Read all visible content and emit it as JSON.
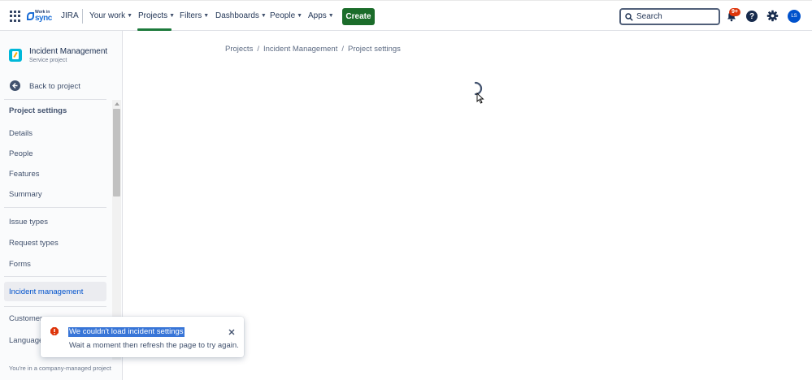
{
  "topnav": {
    "logo_line1": "Work in",
    "logo_line2": "sync",
    "product": "JIRA",
    "items": [
      {
        "label": "Your work"
      },
      {
        "label": "Projects"
      },
      {
        "label": "Filters"
      },
      {
        "label": "Dashboards"
      },
      {
        "label": "People"
      },
      {
        "label": "Apps"
      }
    ],
    "active_item": "Projects",
    "create_label": "Create",
    "search_placeholder": "Search",
    "notification_badge": "9+",
    "help_glyph": "?",
    "avatar_initials": "LS",
    "icons": [
      "app-switcher-icon",
      "search-icon",
      "bell-icon",
      "help-icon",
      "gear-icon"
    ],
    "colors": {
      "create": "#1b6c2a",
      "active_underline": "#1d7a3c",
      "badge": "#de350b",
      "avatar": "#0052cc"
    }
  },
  "sidebar": {
    "project_name": "Incident Management",
    "project_type": "Service project",
    "back_label": "Back to project",
    "heading": "Project settings",
    "groups": [
      [
        {
          "label": "Details"
        },
        {
          "label": "People"
        },
        {
          "label": "Features"
        },
        {
          "label": "Summary"
        }
      ],
      [
        {
          "label": "Issue types"
        },
        {
          "label": "Request types"
        },
        {
          "label": "Forms"
        }
      ],
      [
        {
          "label": "Incident management"
        }
      ],
      [
        {
          "label": "Customer"
        },
        {
          "label": "Language"
        }
      ]
    ],
    "selected_item": "Incident management",
    "footer": "You're in a company-managed project"
  },
  "breadcrumb": [
    "Projects",
    "Incident Management",
    "Project settings"
  ],
  "breadcrumb_separator": "/",
  "loading": {
    "icon": "spinner-icon"
  },
  "toast": {
    "title": "We couldn't load incident settings",
    "body": "Wait a moment then refresh the page to try again.",
    "icons": [
      "error-icon",
      "close-icon"
    ],
    "colors": {
      "error": "#de350b",
      "selection": "#3875d7"
    }
  }
}
